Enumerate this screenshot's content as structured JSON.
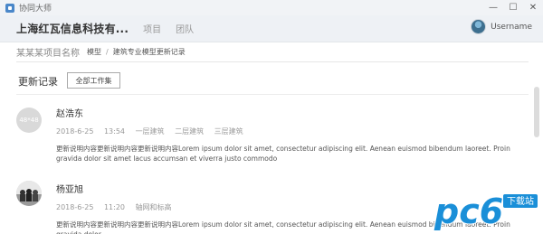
{
  "titlebar": {
    "app_name": "协同大师",
    "minimize": "—",
    "maximize": "☐",
    "close": "✕"
  },
  "header": {
    "company": "上海红瓦信息科技有...",
    "nav": [
      "项目",
      "团队"
    ],
    "username": "Username"
  },
  "breadcrumb": {
    "project": "某某某项目名称",
    "link": "模型",
    "separator": "/",
    "current": "建筑专业模型更新记录"
  },
  "section": {
    "title": "更新记录",
    "filter_label": "全部工作集"
  },
  "records": [
    {
      "avatar_text": "48*48",
      "name": "赵浩东",
      "date": "2018-6-25",
      "time": "13:54",
      "tags": [
        "一层建筑",
        "二层建筑",
        "三层建筑"
      ],
      "body": "更新说明内容更新说明内容更新说明内容Lorem ipsum dolor sit amet, consectetur adipiscing elit. Aenean euismod bibendum laoreet. Proin gravida dolor sit amet lacus accumsan et viverra justo commodo"
    },
    {
      "name": "杨亚旭",
      "date": "2018-6-25",
      "time": "11:20",
      "tags": [
        "轴网和标高"
      ],
      "body": "更新说明内容更新说明内容更新说明内容Lorem ipsum dolor sit amet, consectetur adipiscing elit. Aenean euismod bibendum laoreet. Proin gravida dolor"
    }
  ],
  "watermark": {
    "text": "pc6",
    "sub": "下载站"
  },
  "colors": {
    "accent": "#4a87c9",
    "header_bg": "#eef1f5",
    "titlebar_bg": "#f1f3f6",
    "watermark": "#1a8fd8"
  }
}
